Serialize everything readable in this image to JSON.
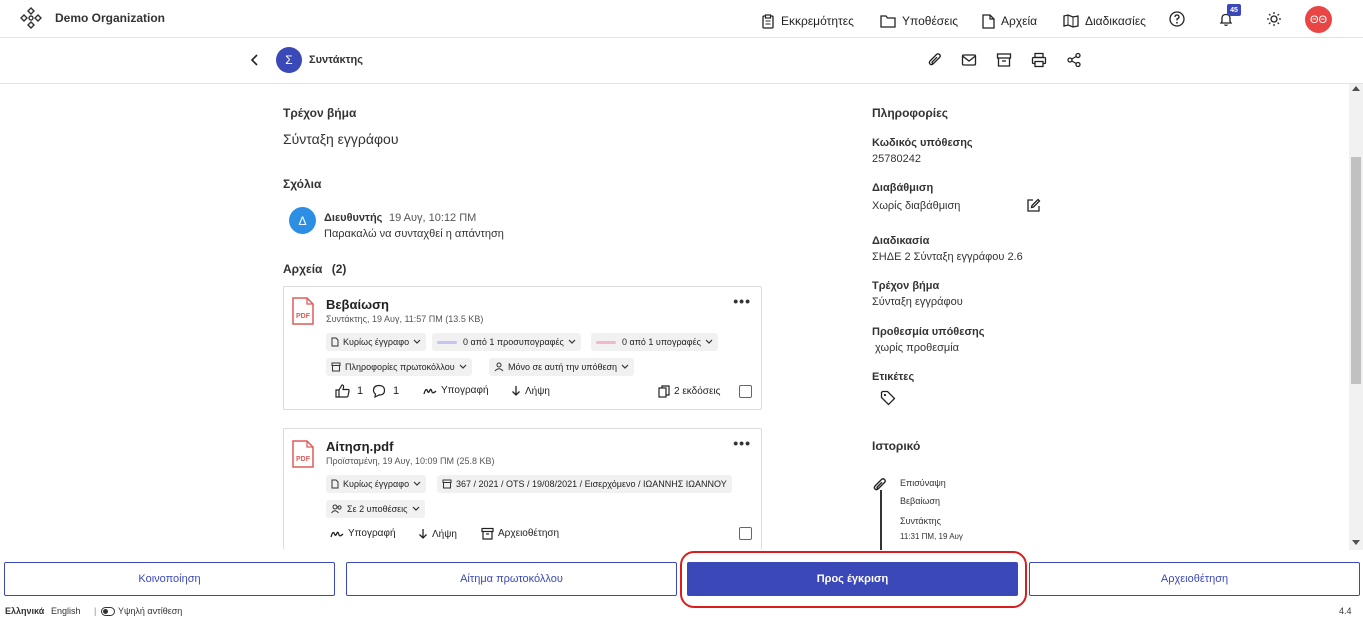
{
  "header": {
    "org_name": "Demo Organization",
    "nav": [
      {
        "label": "Εκκρεμότητες",
        "icon": "clipboard-icon"
      },
      {
        "label": "Υποθέσεις",
        "icon": "folder-icon"
      },
      {
        "label": "Αρχεία",
        "icon": "file-icon"
      },
      {
        "label": "Διαδικασίες",
        "icon": "map-icon"
      }
    ],
    "notification_count": "45",
    "user_initials": "ΘΘ"
  },
  "subheader": {
    "role_initial": "Σ",
    "role_name": "Συντάκτης"
  },
  "main": {
    "current_step_title": "Τρέχον βήμα",
    "current_step_value": "Σύνταξη εγγράφου",
    "comments_title": "Σχόλια",
    "comment": {
      "avatar_initial": "Δ",
      "author": "Διευθυντής",
      "time": "19 Αυγ, 10:12 ΠΜ",
      "text": "Παρακαλώ να συνταχθεί η απάντηση"
    },
    "files_title": "Αρχεία",
    "files_count": "(2)",
    "files": [
      {
        "name": "Βεβαίωση",
        "meta": "Συντάκτης, 19 Αυγ, 11:57 ΠΜ (13.5 KB)",
        "chip_type": "Κυρίως έγγραφο",
        "chip_initials": "0 από 1 προσυπογραφές",
        "chip_signatures": "0 από 1 υπογραφές",
        "chip_protocol": "Πληροφορίες πρωτοκόλλου",
        "chip_scope": "Μόνο σε αυτή την υπόθεση",
        "likes": "1",
        "comments": "1",
        "sign_label": "Υπογραφή",
        "download_label": "Λήψη",
        "versions_label": "2 εκδόσεις"
      },
      {
        "name": "Αίτηση.pdf",
        "meta": "Προϊσταμένη, 19 Αυγ, 10:09 ΠΜ (25.8 KB)",
        "chip_type": "Κυρίως έγγραφο",
        "chip_protocol": "367 / 2021 / OTS / 19/08/2021 / Εισερχόμενο / ΙΩΑΝΝΗΣ ΙΩΑΝΝΟΥ",
        "chip_scope": "Σε 2 υποθέσεις",
        "sign_label": "Υπογραφή",
        "download_label": "Λήψη",
        "archive_label": "Αρχειοθέτηση"
      }
    ]
  },
  "info": {
    "title": "Πληροφορίες",
    "case_code_label": "Κωδικός υπόθεσης",
    "case_code": "25780242",
    "classification_label": "Διαβάθμιση",
    "classification": "Χωρίς διαβάθμιση",
    "process_label": "Διαδικασία",
    "process": "ΣΗΔΕ 2 Σύνταξη εγγράφου 2.6",
    "step_label": "Τρέχον βήμα",
    "step": "Σύνταξη εγγράφου",
    "deadline_label": "Προθεσμία υπόθεσης",
    "deadline": "χωρίς προθεσμία",
    "tags_label": "Ετικέτες",
    "history_title": "Ιστορικό",
    "history_item": {
      "action": "Επισύναψη",
      "object": "Βεβαίωση",
      "actor": "Συντάκτης",
      "time": "11:31 ΠΜ, 19 Αυγ"
    }
  },
  "footer": {
    "btn_notify": "Κοινοποίηση",
    "btn_protocol": "Αίτημα πρωτοκόλλου",
    "btn_approve": "Προς έγκριση",
    "btn_archive": "Αρχειοθέτηση"
  },
  "statusbar": {
    "lang_el": "Ελληνικά",
    "lang_en": "English",
    "contrast": "Υψηλή αντίθεση",
    "version": "4.4"
  },
  "colors": {
    "primary": "#3b49b8",
    "avatar_user": "#e94545",
    "avatar_comment": "#2d8fe3",
    "highlight": "#d81e1e"
  }
}
